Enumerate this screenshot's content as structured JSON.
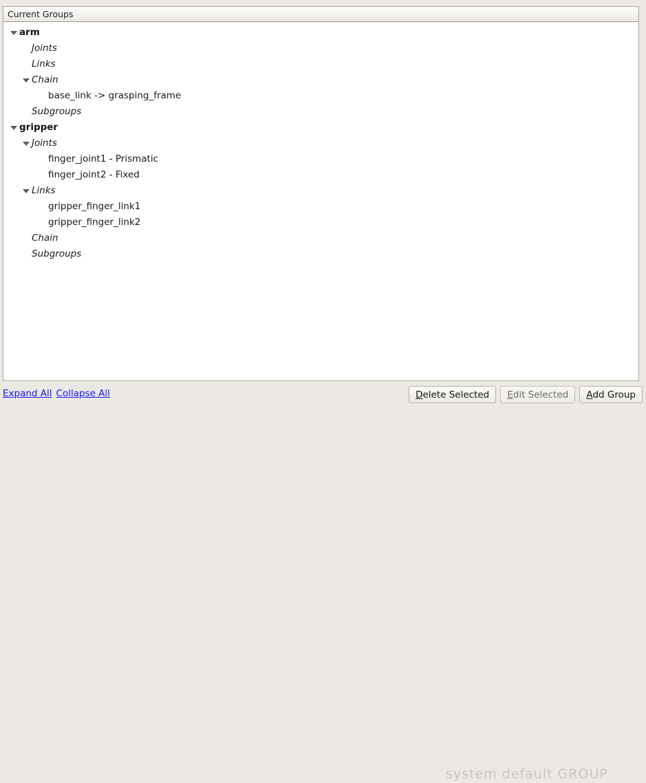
{
  "panel": {
    "header_title": "Current Groups"
  },
  "tree": {
    "nodes": [
      {
        "label": "arm",
        "depth": 0,
        "type": "group",
        "twisty": "open"
      },
      {
        "label": "Joints",
        "depth": 1,
        "type": "section",
        "twisty": "none"
      },
      {
        "label": "Links",
        "depth": 1,
        "type": "section",
        "twisty": "none"
      },
      {
        "label": "Chain",
        "depth": 1,
        "type": "section",
        "twisty": "open"
      },
      {
        "label": "base_link  ->  grasping_frame",
        "depth": 2,
        "type": "leaf",
        "twisty": "none"
      },
      {
        "label": "Subgroups",
        "depth": 1,
        "type": "section",
        "twisty": "none"
      },
      {
        "label": "gripper",
        "depth": 0,
        "type": "group",
        "twisty": "open"
      },
      {
        "label": "Joints",
        "depth": 1,
        "type": "section",
        "twisty": "open"
      },
      {
        "label": "finger_joint1 - Prismatic",
        "depth": 2,
        "type": "leaf",
        "twisty": "none"
      },
      {
        "label": "finger_joint2 - Fixed",
        "depth": 2,
        "type": "leaf",
        "twisty": "none"
      },
      {
        "label": "Links",
        "depth": 1,
        "type": "section",
        "twisty": "open"
      },
      {
        "label": "gripper_finger_link1",
        "depth": 2,
        "type": "leaf",
        "twisty": "none"
      },
      {
        "label": "gripper_finger_link2",
        "depth": 2,
        "type": "leaf",
        "twisty": "none"
      },
      {
        "label": "Chain",
        "depth": 1,
        "type": "section",
        "twisty": "none"
      },
      {
        "label": "Subgroups",
        "depth": 1,
        "type": "section",
        "twisty": "none"
      }
    ]
  },
  "bottom": {
    "expand_all_label": "Expand All",
    "collapse_all_label": "Collapse All",
    "buttons": [
      {
        "mnemonic": "D",
        "rest": "elete Selected",
        "disabled": false,
        "name": "delete-selected-button"
      },
      {
        "mnemonic": "E",
        "rest": "dit Selected",
        "disabled": true,
        "name": "edit-selected-button"
      },
      {
        "mnemonic": "A",
        "rest": "dd Group",
        "disabled": false,
        "name": "add-group-button"
      }
    ]
  },
  "watermark": {
    "text": "system default GROUP"
  },
  "colors": {
    "link": "#1414ff",
    "panel_border": "#a9a6a1",
    "window_background": "#ece9e4",
    "tree_background": "#ffffff"
  }
}
